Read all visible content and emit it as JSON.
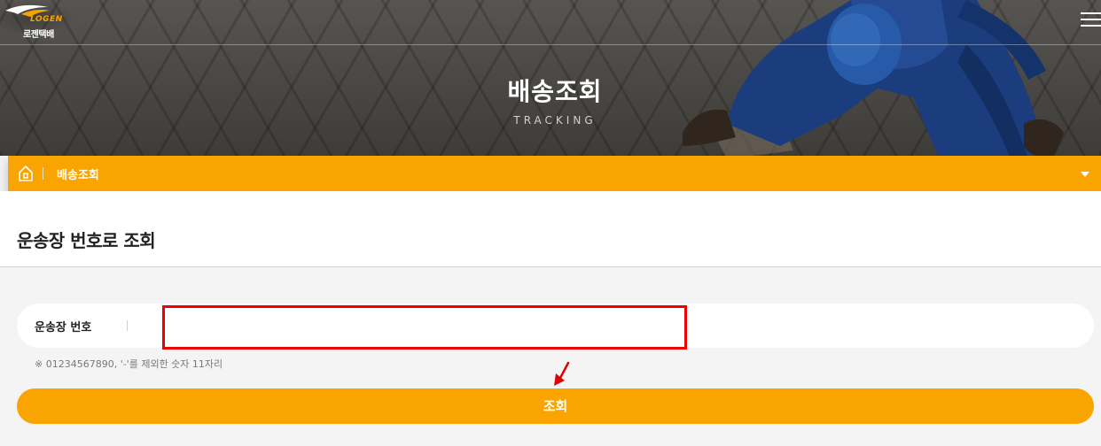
{
  "brand": {
    "logo_en": "LOGEN",
    "logo_ko": "로젠택배",
    "accent": "#f9a400"
  },
  "header": {
    "menu_icon": "hamburger-menu-icon"
  },
  "hero": {
    "title": "배송조회",
    "subtitle": "TRACKING"
  },
  "breadcrumb": {
    "home_icon": "home-icon",
    "current": "배송조회",
    "dropdown_icon": "caret-down-icon"
  },
  "section": {
    "title": "운송장 번호로 조회"
  },
  "form": {
    "label": "운송장 번호",
    "input_value": "",
    "hint": "※ 01234567890, '-'를 제외한 숫자 11자리",
    "submit_label": "조회"
  },
  "annotation": {
    "highlight_color": "#f00000"
  }
}
